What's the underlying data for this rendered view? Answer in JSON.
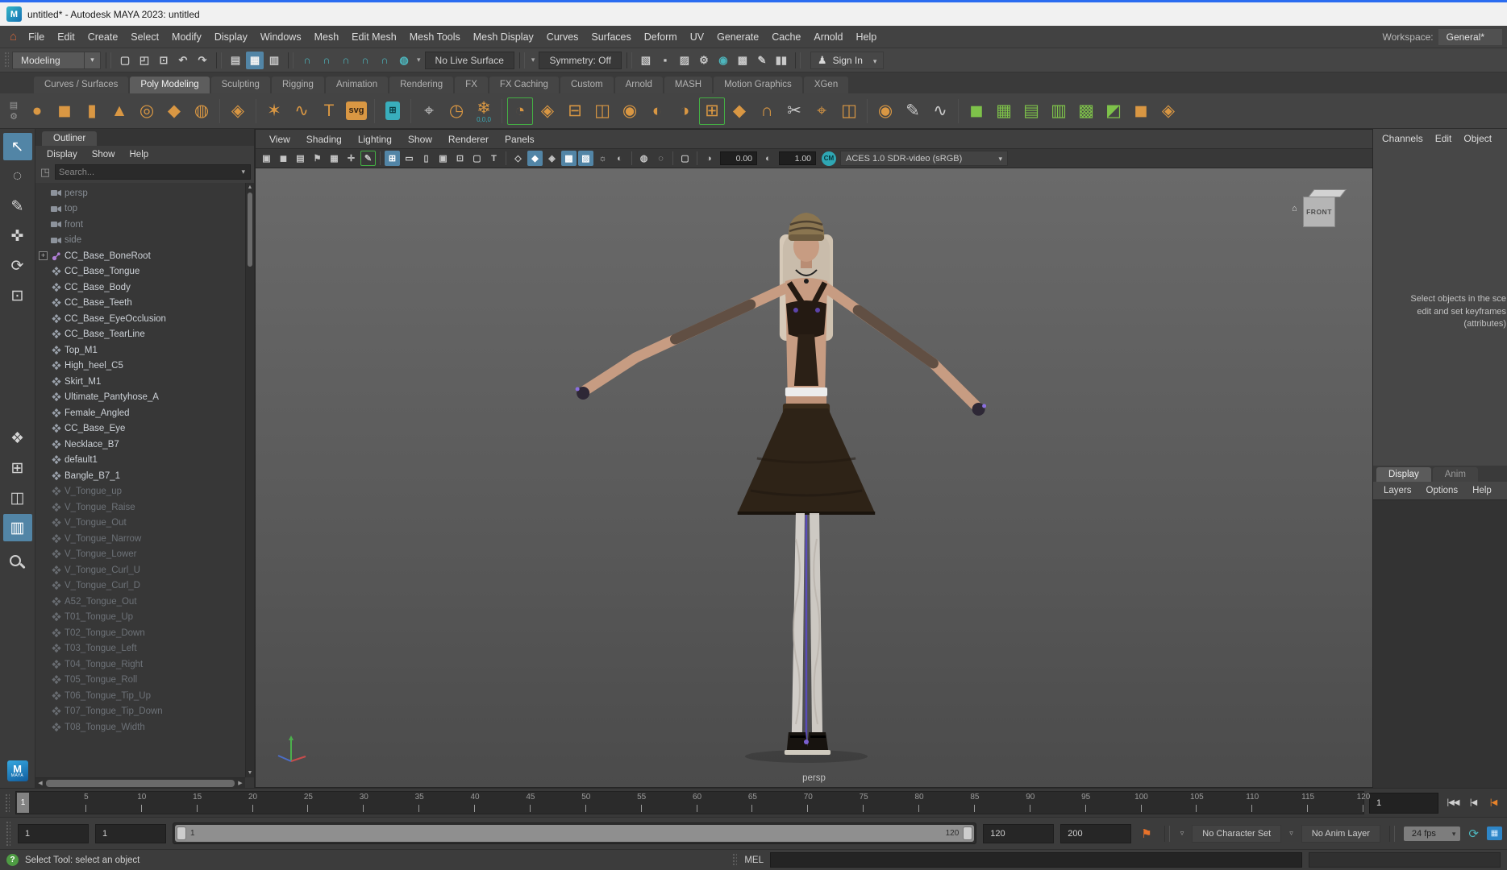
{
  "colors": {
    "accent_blue": "#5285a6",
    "shelf_orange": "#d99743",
    "teal": "#4db6bd",
    "green": "#7ec24a",
    "titlebar_blue": "#2a6cf0",
    "maya_badge_blue": "#1f7ec2",
    "bookmark_orange": "#e8722a",
    "joint_purple": "#b07fd6"
  },
  "window": {
    "title": "untitled* - Autodesk MAYA 2023: untitled",
    "app_icon_letter": "M"
  },
  "menu_bar": {
    "items": [
      "File",
      "Edit",
      "Create",
      "Select",
      "Modify",
      "Display",
      "Windows",
      "Mesh",
      "Edit Mesh",
      "Mesh Tools",
      "Mesh Display",
      "Curves",
      "Surfaces",
      "Deform",
      "UV",
      "Generate",
      "Cache",
      "Arnold",
      "Help"
    ],
    "workspace_label": "Workspace:",
    "workspace_value": "General*"
  },
  "status_line": {
    "mode": "Modeling",
    "file_icons": [
      {
        "n": "new-scene-icon",
        "g": "▢"
      },
      {
        "n": "open-scene-icon",
        "g": "◰"
      },
      {
        "n": "save-scene-icon",
        "g": "⊡"
      },
      {
        "n": "undo-icon",
        "g": "↶"
      },
      {
        "n": "redo-icon",
        "g": "↷"
      }
    ],
    "selection_icons": [
      {
        "n": "select-by-hierarchy-icon",
        "g": "▤"
      },
      {
        "n": "select-by-object-icon",
        "g": "▦",
        "active": true
      },
      {
        "n": "select-by-component-icon",
        "g": "▥"
      }
    ],
    "snap_icons": [
      {
        "n": "snap-to-grid-icon",
        "g": "∩",
        "c": "teal"
      },
      {
        "n": "snap-to-curve-icon",
        "g": "∩",
        "c": "teal"
      },
      {
        "n": "snap-to-point-icon",
        "g": "∩",
        "c": "teal"
      },
      {
        "n": "snap-to-projected-center-icon",
        "g": "∩",
        "c": "teal"
      },
      {
        "n": "snap-to-view-plane-icon",
        "g": "∩",
        "c": "teal"
      },
      {
        "n": "make-object-live-icon",
        "g": "◍",
        "c": "teal"
      }
    ],
    "live_surface": "No Live Surface",
    "symmetry": "Symmetry: Off",
    "render_icons": [
      {
        "n": "render-current-frame-icon",
        "g": "▧"
      },
      {
        "n": "render-region-icon",
        "g": "▪"
      },
      {
        "n": "ipr-render-icon",
        "g": "▨"
      },
      {
        "n": "render-settings-icon",
        "g": "⚙"
      },
      {
        "n": "light-editor-icon",
        "g": "◉",
        "c": "teal"
      },
      {
        "n": "render-setup-icon",
        "g": "▩"
      },
      {
        "n": "paint-effects-icon",
        "g": "✎"
      },
      {
        "n": "pause-viewport-icon",
        "g": "▮▮"
      }
    ],
    "sign_in": "Sign In"
  },
  "shelf": {
    "tabs": [
      "Curves / Surfaces",
      "Poly Modeling",
      "Sculpting",
      "Rigging",
      "Animation",
      "Rendering",
      "FX",
      "FX Caching",
      "Custom",
      "Arnold",
      "MASH",
      "Motion Graphics",
      "XGen"
    ],
    "active_tab": "Poly Modeling",
    "gear_icon": "⚙",
    "menu_icon": "▤",
    "icons": [
      {
        "n": "poly-sphere-icon",
        "g": "●",
        "c": "or"
      },
      {
        "n": "poly-cube-icon",
        "g": "◼",
        "c": "or"
      },
      {
        "n": "poly-cylinder-icon",
        "g": "▮",
        "c": "or"
      },
      {
        "n": "poly-cone-icon",
        "g": "▲",
        "c": "or"
      },
      {
        "n": "poly-torus-icon",
        "g": "◎",
        "c": "or"
      },
      {
        "n": "poly-plane-icon",
        "g": "◆",
        "c": "or"
      },
      {
        "n": "poly-disc-icon",
        "g": "◍",
        "c": "or"
      },
      {
        "div": true
      },
      {
        "n": "platonic-solid-icon",
        "g": "◈",
        "c": "or"
      },
      {
        "div": true
      },
      {
        "n": "sweep-mesh-icon",
        "g": "✶",
        "c": "or"
      },
      {
        "n": "poly-helix-icon",
        "g": "∿",
        "c": "or"
      },
      {
        "n": "type-tool-icon",
        "g": "T",
        "c": "or"
      },
      {
        "n": "svg-tool-icon",
        "g": "svg",
        "c": "or",
        "box": true
      },
      {
        "div": true
      },
      {
        "n": "modeling-toolkit-icon",
        "g": "⊞",
        "c": "tl",
        "box": true
      },
      {
        "div": true
      },
      {
        "n": "universal-manipulator-icon",
        "g": "⌖",
        "c": "gy"
      },
      {
        "n": "delete-history-icon",
        "g": "◷",
        "c": "tl"
      },
      {
        "n": "freeze-transformations-icon",
        "g": "❄",
        "c": "tl",
        "sub": "0,0,0"
      },
      {
        "div": true
      },
      {
        "n": "combine-icon",
        "g": "◔",
        "c": "or",
        "br": true
      },
      {
        "n": "separate-icon",
        "g": "◈",
        "c": "or"
      },
      {
        "n": "extract-icon",
        "g": "⊟",
        "c": "or"
      },
      {
        "n": "duplicate-face-icon",
        "g": "◫",
        "c": "or"
      },
      {
        "n": "boolean-union-icon",
        "g": "◉",
        "c": "or"
      },
      {
        "n": "boolean-difference-icon",
        "g": "◐",
        "c": "or"
      },
      {
        "n": "boolean-intersection-icon",
        "g": "◑",
        "c": "or"
      },
      {
        "n": "extrude-icon",
        "g": "⊞",
        "c": "or",
        "br": true
      },
      {
        "n": "bevel-icon",
        "g": "◆",
        "c": "or"
      },
      {
        "n": "bridge-icon",
        "g": "∩",
        "c": "or"
      },
      {
        "n": "multi-cut-icon",
        "g": "✂",
        "c": "gy"
      },
      {
        "n": "target-weld-icon",
        "g": "⌖",
        "c": "or"
      },
      {
        "n": "mirror-icon",
        "g": "◫",
        "c": "or"
      },
      {
        "div": true
      },
      {
        "n": "smooth-icon",
        "g": "◉",
        "c": "or"
      },
      {
        "n": "crease-tool-icon",
        "g": "✎",
        "c": "gy"
      },
      {
        "n": "edge-flow-icon",
        "g": "∿",
        "c": "gy"
      },
      {
        "div": true
      },
      {
        "n": "object-mode-icon",
        "g": "◼",
        "c": "gr"
      },
      {
        "n": "vertex-mode-icon",
        "g": "▦",
        "c": "gr"
      },
      {
        "n": "edge-mode-icon",
        "g": "▤",
        "c": "gr"
      },
      {
        "n": "face-mode-icon",
        "g": "▥",
        "c": "gr"
      },
      {
        "n": "uv-mode-icon",
        "g": "▩",
        "c": "gr"
      },
      {
        "n": "multi-component-icon",
        "g": "◩",
        "c": "gr"
      },
      {
        "n": "smooth-mesh-preview-icon",
        "g": "◼",
        "c": "tl"
      },
      {
        "n": "subdiv-proxy-icon",
        "g": "◈",
        "c": "tl"
      }
    ]
  },
  "toolbox": {
    "tools": [
      {
        "n": "select-tool",
        "g": "↖",
        "active": true
      },
      {
        "n": "lasso-select-tool",
        "g": "◌"
      },
      {
        "n": "paint-selection-tool",
        "g": "✎"
      },
      {
        "n": "move-tool",
        "g": "✜"
      },
      {
        "n": "rotate-tool",
        "g": "⟳"
      },
      {
        "n": "scale-tool",
        "g": "⊡"
      }
    ],
    "layouts": [
      {
        "n": "single-pane-layout",
        "g": "❖"
      },
      {
        "n": "four-pane-layout",
        "g": "⊞"
      },
      {
        "n": "split-pane-layout",
        "g": "◫"
      },
      {
        "n": "outliner-persp-layout",
        "g": "▥",
        "active": true
      }
    ],
    "badge_letter": "M",
    "badge_sub": "MAYA"
  },
  "outliner": {
    "tab": "Outliner",
    "menus": [
      "Display",
      "Show",
      "Help"
    ],
    "search_placeholder": "Search...",
    "filter_icon": "◳",
    "items": [
      {
        "icon": "camera",
        "label": "persp",
        "dim": true
      },
      {
        "icon": "camera",
        "label": "top",
        "dim": true
      },
      {
        "icon": "camera",
        "label": "front",
        "dim": true
      },
      {
        "icon": "camera",
        "label": "side",
        "dim": true
      },
      {
        "icon": "joint",
        "label": "CC_Base_BoneRoot",
        "expand": true
      },
      {
        "icon": "mesh",
        "label": "CC_Base_Tongue"
      },
      {
        "icon": "mesh",
        "label": "CC_Base_Body"
      },
      {
        "icon": "mesh",
        "label": "CC_Base_Teeth"
      },
      {
        "icon": "mesh",
        "label": "CC_Base_EyeOcclusion"
      },
      {
        "icon": "mesh",
        "label": "CC_Base_TearLine"
      },
      {
        "icon": "mesh",
        "label": "Top_M1"
      },
      {
        "icon": "mesh",
        "label": "High_heel_C5"
      },
      {
        "icon": "mesh",
        "label": "Skirt_M1"
      },
      {
        "icon": "mesh",
        "label": "Ultimate_Pantyhose_A"
      },
      {
        "icon": "mesh",
        "label": "Female_Angled"
      },
      {
        "icon": "mesh",
        "label": "CC_Base_Eye"
      },
      {
        "icon": "mesh",
        "label": "Necklace_B7"
      },
      {
        "icon": "mesh",
        "label": "default1"
      },
      {
        "icon": "mesh",
        "label": "Bangle_B7_1"
      },
      {
        "icon": "mesh",
        "label": "V_Tongue_up",
        "muted": true
      },
      {
        "icon": "mesh",
        "label": "V_Tongue_Raise",
        "muted": true
      },
      {
        "icon": "mesh",
        "label": "V_Tongue_Out",
        "muted": true
      },
      {
        "icon": "mesh",
        "label": "V_Tongue_Narrow",
        "muted": true
      },
      {
        "icon": "mesh",
        "label": "V_Tongue_Lower",
        "muted": true
      },
      {
        "icon": "mesh",
        "label": "V_Tongue_Curl_U",
        "muted": true
      },
      {
        "icon": "mesh",
        "label": "V_Tongue_Curl_D",
        "muted": true
      },
      {
        "icon": "mesh",
        "label": "A52_Tongue_Out",
        "muted": true
      },
      {
        "icon": "mesh",
        "label": "T01_Tongue_Up",
        "muted": true
      },
      {
        "icon": "mesh",
        "label": "T02_Tongue_Down",
        "muted": true
      },
      {
        "icon": "mesh",
        "label": "T03_Tongue_Left",
        "muted": true
      },
      {
        "icon": "mesh",
        "label": "T04_Tongue_Right",
        "muted": true
      },
      {
        "icon": "mesh",
        "label": "T05_Tongue_Roll",
        "muted": true
      },
      {
        "icon": "mesh",
        "label": "T06_Tongue_Tip_Up",
        "muted": true
      },
      {
        "icon": "mesh",
        "label": "T07_Tongue_Tip_Down",
        "muted": true
      },
      {
        "icon": "mesh",
        "label": "T08_Tongue_Width",
        "muted": true
      }
    ]
  },
  "viewport": {
    "menus": [
      "View",
      "Shading",
      "Lighting",
      "Show",
      "Renderer",
      "Panels"
    ],
    "toolbar_icons_a": [
      {
        "n": "select-camera-icon",
        "g": "▣"
      },
      {
        "n": "lock-camera-icon",
        "g": "◼"
      },
      {
        "n": "camera-attributes-icon",
        "g": "▤"
      },
      {
        "n": "bookmark-icon",
        "g": "⚑"
      },
      {
        "n": "image-plane-icon",
        "g": "▦"
      },
      {
        "n": "two-d-pan-zoom-icon",
        "g": "✛"
      },
      {
        "n": "grease-pencil-icon",
        "g": "✎",
        "br": true
      },
      {
        "div": true
      },
      {
        "n": "grid-icon",
        "g": "⊞",
        "active": true
      },
      {
        "n": "film-gate-icon",
        "g": "▭"
      },
      {
        "n": "resolution-gate-icon",
        "g": "▯"
      },
      {
        "n": "gate-mask-icon",
        "g": "▣"
      },
      {
        "n": "field-chart-icon",
        "g": "⊡"
      },
      {
        "n": "safe-action-icon",
        "g": "▢"
      },
      {
        "n": "safe-title-icon",
        "g": "T"
      },
      {
        "div": true
      },
      {
        "n": "wireframe-icon",
        "g": "◇"
      },
      {
        "n": "shaded-icon",
        "g": "◆",
        "active": true
      },
      {
        "n": "wireframe-on-shaded-icon",
        "g": "◈"
      },
      {
        "n": "textured-icon",
        "g": "▩",
        "active": true
      },
      {
        "n": "use-default-material-icon",
        "g": "▨",
        "active": true
      },
      {
        "n": "lighting-icon",
        "g": "☼"
      },
      {
        "n": "shadows-icon",
        "g": "◐"
      },
      {
        "div": true
      },
      {
        "n": "occlusion-icon",
        "g": "◍"
      },
      {
        "n": "motion-blur-icon",
        "g": "◌"
      },
      {
        "div": true
      },
      {
        "n": "isolate-select-icon",
        "g": "▢"
      },
      {
        "div": true
      },
      {
        "n": "exposure-icon",
        "g": "◑"
      }
    ],
    "exposure": "0.00",
    "toolbar_icons_b": [
      {
        "n": "gamma-icon",
        "g": "◐"
      }
    ],
    "gamma": "1.00",
    "cm_icon": "CM",
    "colorspace": "ACES 1.0 SDR-video (sRGB)",
    "viewcube_label": "FRONT",
    "viewcube_home_icon": "⌂",
    "camera_label": "persp"
  },
  "channel_box": {
    "menus": [
      "Channels",
      "Edit",
      "Object"
    ],
    "hint_lines": [
      "Select objects in the sce",
      "edit and set keyframes",
      "(attributes)"
    ]
  },
  "display_panel": {
    "tabs": [
      "Display",
      "Anim"
    ],
    "active_tab": "Display",
    "menus": [
      "Layers",
      "Options",
      "Help"
    ]
  },
  "time_slider": {
    "ticks": [
      5,
      10,
      15,
      20,
      25,
      30,
      35,
      40,
      45,
      50,
      55,
      60,
      65,
      70,
      75,
      80,
      85,
      90,
      95,
      100,
      105,
      110,
      115,
      120
    ],
    "current_frame": "1",
    "frame_field": "1",
    "playback": [
      {
        "n": "go-to-start-button",
        "g": "|◀◀"
      },
      {
        "n": "step-back-frame-button",
        "g": "|◀"
      },
      {
        "n": "step-back-key-button",
        "g": "|◀",
        "key": true
      }
    ]
  },
  "range_slider": {
    "playback_start": "1",
    "animation_start": "1",
    "handle_start_label": "1",
    "handle_end_label": "120",
    "playback_end": "120",
    "animation_end": "200",
    "bookmark_icon": "⚑",
    "character_set": "No Character Set",
    "anim_layer": "No Anim Layer",
    "fps": "24 fps",
    "loop_icon": "⟳",
    "film_icon": "▦"
  },
  "help_line": {
    "icon": "?",
    "text": "Select Tool: select an object"
  },
  "command_line": {
    "label": "MEL"
  }
}
